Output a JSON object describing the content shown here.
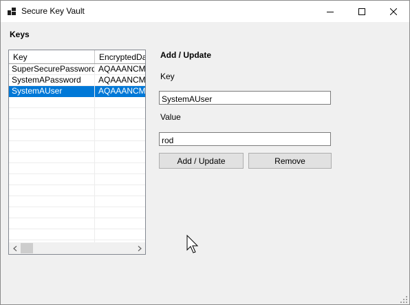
{
  "window": {
    "title": "Secure Key Vault"
  },
  "keys_section": {
    "title": "Keys",
    "columns": [
      "Key",
      "EncryptedDa"
    ],
    "rows": [
      {
        "key": "SuperSecurePassword",
        "encrypted": "AQAAANCM",
        "selected": false
      },
      {
        "key": "SystemAPassword",
        "encrypted": "AQAAANCM",
        "selected": false
      },
      {
        "key": "SystemAUser",
        "encrypted": "AQAAANCM",
        "selected": true
      }
    ]
  },
  "editor": {
    "title": "Add / Update",
    "key_label": "Key",
    "key_value": "SystemAUser",
    "value_label": "Value",
    "value_value": "rod",
    "add_update_button": "Add / Update",
    "remove_button": "Remove"
  },
  "colors": {
    "selection": "#0078d7",
    "background": "#f0f0f0"
  },
  "icons": [
    "app-icon",
    "minimize-icon",
    "maximize-icon",
    "close-icon",
    "scroll-left-icon",
    "scroll-right-icon",
    "mouse-cursor-icon",
    "resize-grip-icon"
  ]
}
